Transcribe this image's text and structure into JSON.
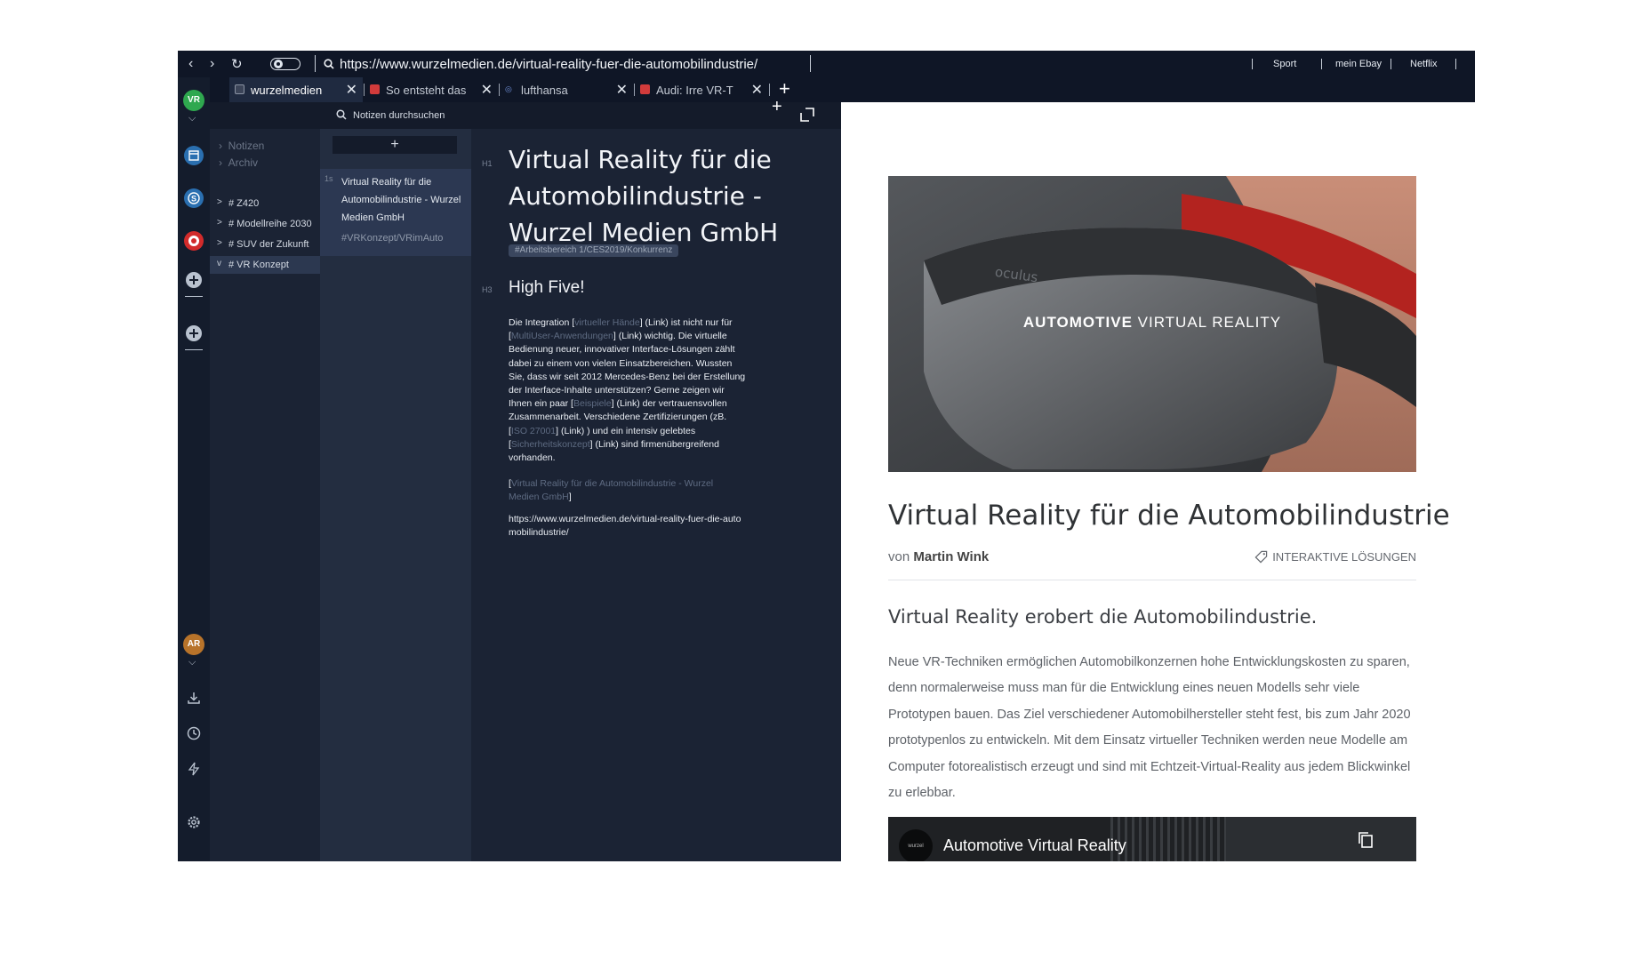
{
  "browser": {
    "url": "https://www.wurzelmedien.de/virtual-reality-fuer-die-automobilindustrie/",
    "bookmarks": [
      "Sport",
      "mein Ebay",
      "Netflix"
    ],
    "tabs": [
      {
        "label": "wurzelmedien",
        "active": true
      },
      {
        "label": "So entsteht das",
        "active": false
      },
      {
        "label": "lufthansa",
        "active": false
      },
      {
        "label": "Audi: Irre VR-T",
        "active": false
      }
    ]
  },
  "rail": {
    "workspace_badge": "VR",
    "user_badge": "AR",
    "colors": {
      "vr": "#2fa84f",
      "ar": "#b8732a",
      "red_app": "#d22b2b",
      "blue_app": "#2a6fb0"
    }
  },
  "notes": {
    "search_placeholder": "Notizen durchsuchen",
    "tree_top": [
      "Notizen",
      "Archiv"
    ],
    "tree_items": [
      {
        "label": "# Z420",
        "arrow": ">"
      },
      {
        "label": "# Modellreihe 2030",
        "arrow": ">"
      },
      {
        "label": "# SUV der Zukunft",
        "arrow": ">"
      },
      {
        "label": "# VR Konzept",
        "arrow": "v",
        "selected": true
      }
    ],
    "add_label": "+",
    "note": {
      "timestamp": "1s",
      "title": "Virtual Reality für die Automobilindustrie - Wurzel Medien GmbH",
      "tag": "#VRKonzept/VRimAuto"
    }
  },
  "editor": {
    "h1_mark": "H1",
    "h1": "Virtual Reality für die Automobilindustrie - Wurzel Medien GmbH",
    "tag": "#Arbeitsbereich 1/CES2019/Konkurrenz",
    "h3_mark": "H3",
    "h3": "High Five!",
    "p1_a": "Die Integration [",
    "p1_l1": "virtueller Hände",
    "p1_b": "] (Link) ist nicht nur für [",
    "p1_l2": "MultiUser-Anwendungen",
    "p1_c": "] (Link) wichtig. Die virtuelle Bedienung neuer, innovativer Interface-Lösungen zählt dabei zu einem von vielen Einsatzbereichen. Wussten Sie, dass wir seit 2012 Mercedes-Benz bei der Erstellung der Interface-Inhalte unterstützen? Gerne zeigen wir Ihnen ein paar [",
    "p1_l3": "Beispiele",
    "p1_d": "] (Link) der vertrauensvollen Zusammenarbeit. Verschiedene Zertifizierungen (zB. [",
    "p1_l4": "ISO 27001",
    "p1_e": "] (Link) ) und ein intensiv gelebtes [",
    "p1_l5": "Sicherheitskonzept",
    "p1_f": "] (Link) sind firmenübergreifend vorhanden.",
    "ref_open": "[",
    "ref_link": "Virtual Reality für die Automobilindustrie - Wurzel Medien GmbH",
    "ref_close": "]",
    "url_line": "https://www.wurzelmedien.de/virtual-reality-fuer-die-automobilindustrie/"
  },
  "web": {
    "hero_brand": "oculus",
    "hero_bold": "AUTOMOTIVE",
    "hero_light": " VIRTUAL REALITY",
    "title": "Virtual Reality für die Automobilindustrie",
    "by_prefix": "von ",
    "author": "Martin Wink",
    "category": "INTERAKTIVE LÖSUNGEN",
    "lead": "Virtual Reality erobert die Automobilindustrie.",
    "body": "Neue VR-Techniken ermöglichen Automobilkonzernen hohe Entwicklungskosten zu sparen, denn normalerweise muss man für die Entwicklung eines neuen Modells sehr viele Prototypen bauen. Das Ziel verschiedener Automobilhersteller steht fest, bis zum Jahr 2020 prototypenlos zu entwickeln. Mit dem Einsatz virtueller Techniken werden neue Modelle am Computer fotorealistisch erzeugt und sind mit Echtzeit-Virtual-Reality aus jedem Blickwinkel zu erlebbar.",
    "video_channel": "wurzel medien",
    "video_title": "Automotive Virtual Reality"
  }
}
